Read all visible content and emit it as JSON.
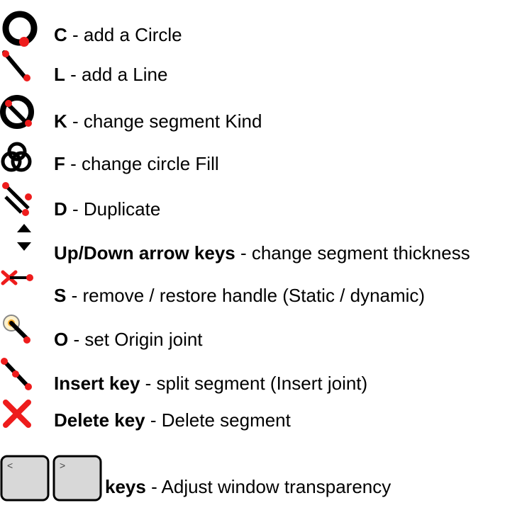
{
  "colors": {
    "red": "#ee1c1c",
    "black": "#000000",
    "faint_green": "#d9f0dc",
    "key_bg": "#d8d8d8"
  },
  "shortcuts": [
    {
      "icon": "circle-icon",
      "key": "C",
      "sep": " - ",
      "desc": "add a Circle"
    },
    {
      "icon": "line-icon",
      "key": "L",
      "sep": " - ",
      "desc": "add a Line"
    },
    {
      "icon": "segment-kind-icon",
      "key": "K",
      "sep": " - ",
      "desc": "change segment Kind"
    },
    {
      "icon": "circle-fill-icon",
      "key": "F",
      "sep": " - ",
      "desc": "change circle Fill"
    },
    {
      "icon": "duplicate-icon",
      "key": "D",
      "sep": " - ",
      "desc": "Duplicate"
    },
    {
      "icon": "up-down-arrows-icon",
      "key": "Up/Down arrow keys",
      "sep": " - ",
      "desc": "change segment thickness"
    },
    {
      "icon": "static-handle-icon",
      "key": "S",
      "sep": " - ",
      "desc": "remove / restore handle (Static / dynamic)"
    },
    {
      "icon": "origin-joint-icon",
      "key": "O",
      "sep": " - ",
      "desc": "set Origin joint"
    },
    {
      "icon": "insert-joint-icon",
      "key": "Insert key",
      "sep": " - ",
      "desc": "split segment (Insert joint)"
    },
    {
      "icon": "delete-icon",
      "key": "Delete key",
      "sep": " - ",
      "desc": "Delete segment"
    }
  ],
  "transparency": {
    "key_left": "<",
    "key_right": ">",
    "keyword": "keys",
    "sep": " - ",
    "desc": "Adjust window transparency"
  }
}
